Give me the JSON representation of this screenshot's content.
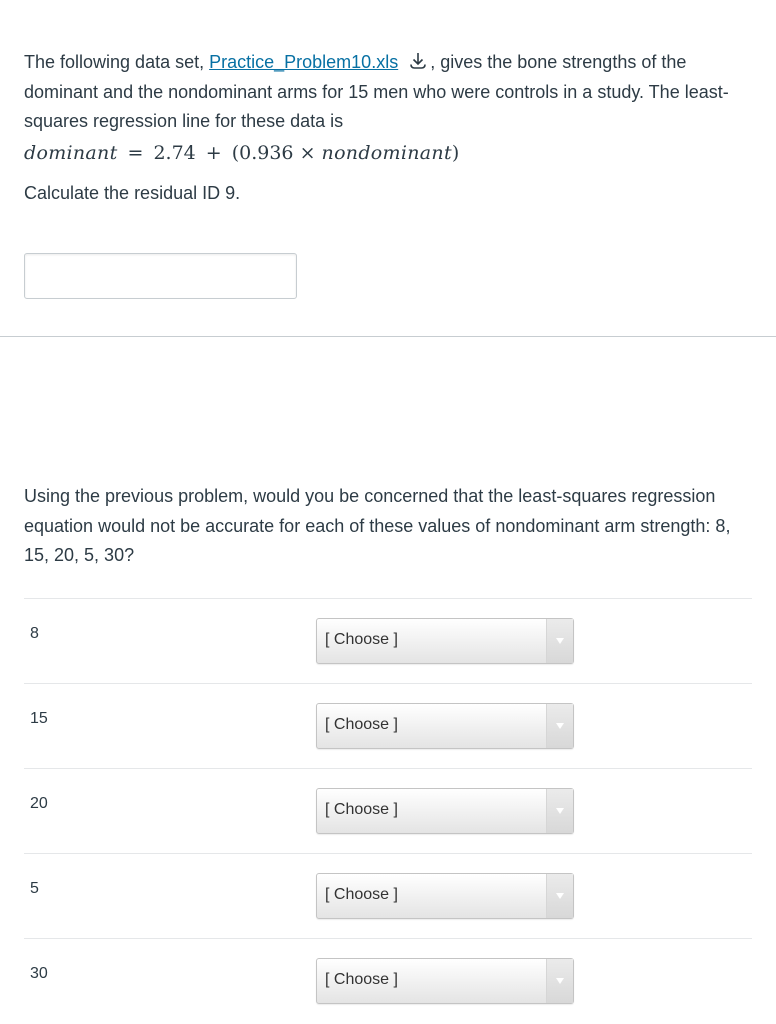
{
  "question1": {
    "text_before_link": "The following data set, ",
    "link_text": "Practice_Problem10.xls",
    "download_icon": "download-icon",
    "text_after_link": ", gives the bone strengths of the dominant and the nondominant arms for 15 men who were controls in a study. The least-squares regression line for these data is",
    "equation": {
      "lhs": "dominant",
      "equals": "=",
      "intercept": "2.74",
      "plus": "+",
      "open": "(",
      "slope": "0.936",
      "times": "×",
      "variable": "nondominant",
      "close": ")"
    },
    "prompt": "Calculate the residual ID 9.",
    "answer_value": "",
    "answer_placeholder": ""
  },
  "question2": {
    "text": "Using the previous problem, would you be concerned that the least-squares regression equation would not be accurate for each of these values of nondominant arm strength: 8, 15, 20, 5, 30?",
    "rows": [
      {
        "label": "8",
        "selected": "[ Choose ]"
      },
      {
        "label": "15",
        "selected": "[ Choose ]"
      },
      {
        "label": "20",
        "selected": "[ Choose ]"
      },
      {
        "label": "5",
        "selected": "[ Choose ]"
      },
      {
        "label": "30",
        "selected": "[ Choose ]"
      }
    ]
  },
  "colors": {
    "text": "#2d3b45",
    "link": "#0770a3",
    "border": "#c7cdd1"
  }
}
